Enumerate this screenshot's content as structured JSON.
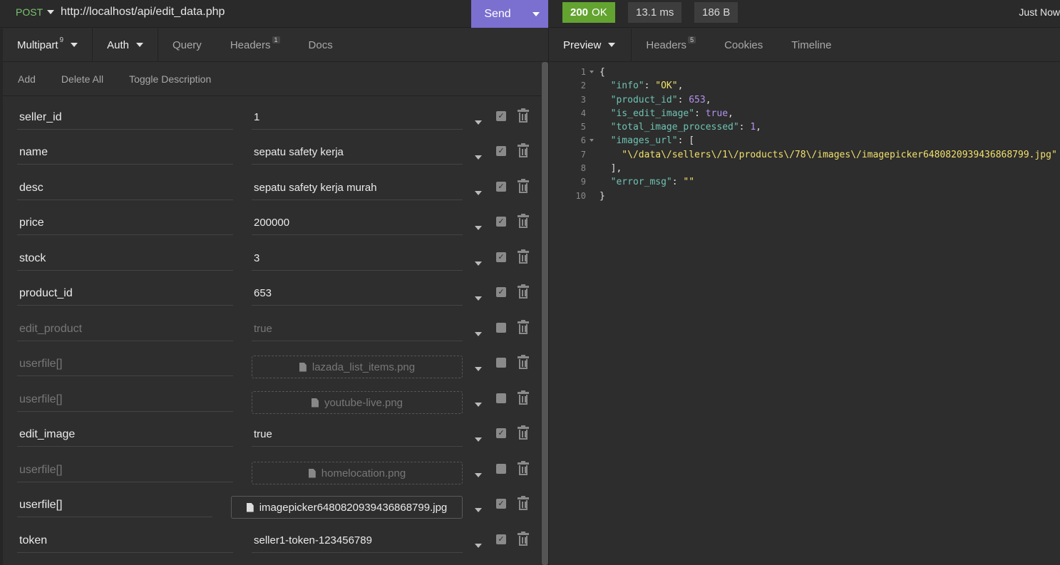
{
  "request": {
    "method": "POST",
    "url": "http://localhost/api/edit_data.php",
    "send_label": "Send"
  },
  "response_meta": {
    "status_code": "200",
    "status_text": "OK",
    "time": "13.1 ms",
    "size": "186 B",
    "when": "Just Now"
  },
  "left_tabs": {
    "body": "Multipart",
    "body_count": "9",
    "auth": "Auth",
    "query": "Query",
    "headers": "Headers",
    "headers_count": "1",
    "docs": "Docs"
  },
  "actions": {
    "add": "Add",
    "delete_all": "Delete All",
    "toggle_description": "Toggle Description"
  },
  "params": [
    {
      "name": "seller_id",
      "value": "1",
      "enabled": true,
      "type": "text"
    },
    {
      "name": "name",
      "value": "sepatu safety kerja",
      "enabled": true,
      "type": "text"
    },
    {
      "name": "desc",
      "value": "sepatu safety kerja murah",
      "enabled": true,
      "type": "text"
    },
    {
      "name": "price",
      "value": "200000",
      "enabled": true,
      "type": "text"
    },
    {
      "name": "stock",
      "value": "3",
      "enabled": true,
      "type": "text"
    },
    {
      "name": "product_id",
      "value": "653",
      "enabled": true,
      "type": "text"
    },
    {
      "name": "edit_product",
      "value": "true",
      "enabled": false,
      "type": "text"
    },
    {
      "name": "userfile[]",
      "value": "lazada_list_items.png",
      "enabled": false,
      "type": "file"
    },
    {
      "name": "userfile[]",
      "value": "youtube-live.png",
      "enabled": false,
      "type": "file"
    },
    {
      "name": "edit_image",
      "value": "true",
      "enabled": true,
      "type": "text"
    },
    {
      "name": "userfile[]",
      "value": "homelocation.png",
      "enabled": false,
      "type": "file"
    },
    {
      "name": "userfile[]",
      "value": "imagepicker6480820939436868799.jpg",
      "enabled": true,
      "type": "file"
    },
    {
      "name": "token",
      "value": "seller1-token-123456789",
      "enabled": true,
      "type": "text"
    }
  ],
  "right_tabs": {
    "preview": "Preview",
    "headers": "Headers",
    "headers_count": "5",
    "cookies": "Cookies",
    "timeline": "Timeline"
  },
  "response_lines": [
    {
      "n": "1",
      "fold": true,
      "html": "{"
    },
    {
      "n": "2",
      "fold": false,
      "key": "info",
      "val": "\"OK\"",
      "vt": "s",
      "tail": ","
    },
    {
      "n": "3",
      "fold": false,
      "key": "product_id",
      "val": "653",
      "vt": "n",
      "tail": ","
    },
    {
      "n": "4",
      "fold": false,
      "key": "is_edit_image",
      "val": "true",
      "vt": "b",
      "tail": ","
    },
    {
      "n": "5",
      "fold": false,
      "key": "total_image_processed",
      "val": "1",
      "vt": "n",
      "tail": ","
    },
    {
      "n": "6",
      "fold": true,
      "key": "images_url",
      "val": "[",
      "vt": "p",
      "tail": ""
    },
    {
      "n": "7",
      "fold": false,
      "str": "\"\\/data\\/sellers\\/1\\/products\\/78\\/images\\/imagepicker6480820939436868799.jpg\""
    },
    {
      "n": "8",
      "fold": false,
      "plain": "  ],"
    },
    {
      "n": "9",
      "fold": false,
      "key": "error_msg",
      "val": "\"\"",
      "vt": "s",
      "tail": ""
    },
    {
      "n": "10",
      "fold": false,
      "plain": "}"
    }
  ]
}
